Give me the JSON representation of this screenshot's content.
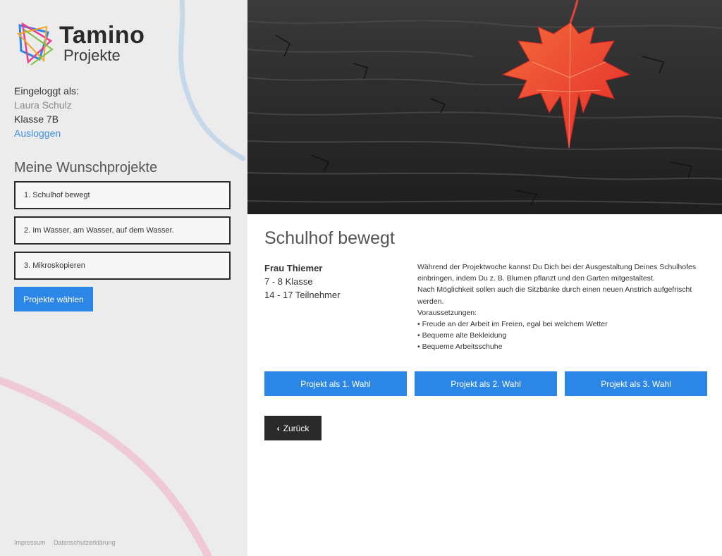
{
  "brand": {
    "name": "Tamino",
    "subtitle": "Projekte"
  },
  "login": {
    "label": "Eingeloggt als:",
    "user": "Laura Schulz",
    "class": "Klasse 7B",
    "logout": "Ausloggen"
  },
  "wishlist": {
    "title": "Meine Wunschprojekte",
    "items": [
      "1. Schulhof bewegt",
      "2. Im Wasser, am Wasser, auf dem Wasser.",
      "3. Mikroskopieren"
    ],
    "submit": "Projekte wählen"
  },
  "footer": {
    "impressum": "Impressum",
    "privacy": "Datenschutzerklärung"
  },
  "project": {
    "title": "Schulhof bewegt",
    "teacher": "Frau Thiemer",
    "grades": "7 - 8 Klasse",
    "participants": "14 - 17 Teilnehmer",
    "description": [
      "Während der Projektwoche kannst Du Dich bei der Ausgestaltung Deines Schulhofes einbringen, indem Du z. B. Blumen pflanzt und den Garten mitgestaltest.",
      "Nach Möglichkeit sollen auch die Sitzbänke durch einen neuen Anstrich aufgefrischt werden.",
      "Voraussetzungen:",
      "• Freude an der Arbeit im Freien, egal bei welchem Wetter",
      "• Bequeme alte Bekleidung",
      "• Bequeme Arbeitsschuhe"
    ]
  },
  "actions": {
    "choice1": "Projekt als 1. Wahl",
    "choice2": "Projekt als 2. Wahl",
    "choice3": "Projekt als 3. Wahl",
    "back": "Zurück"
  },
  "colors": {
    "accent": "#2c86e6",
    "dark": "#2a2a2a",
    "sidebar": "#ececec"
  }
}
